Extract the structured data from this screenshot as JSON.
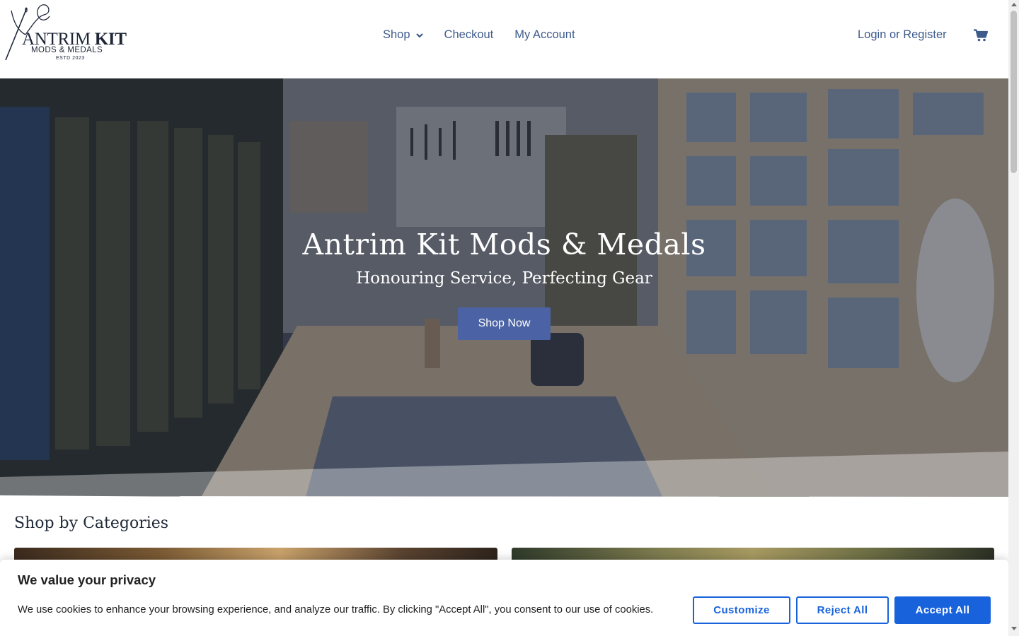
{
  "header": {
    "logo": {
      "name_line": "ANTRIM KIT",
      "subline": "MODS & MEDALS",
      "established": "ESTD 2023"
    },
    "nav": [
      {
        "label": "Shop",
        "has_dropdown": true
      },
      {
        "label": "Checkout"
      },
      {
        "label": "My Account"
      }
    ],
    "login_label": "Login or Register",
    "cart_icon": "cart-icon"
  },
  "hero": {
    "title": "Antrim Kit Mods & Medals",
    "subtitle": "Honouring Service, Perfecting Gear",
    "button_label": "Shop Now"
  },
  "categories": {
    "title": "Shop by Categories"
  },
  "cookie_banner": {
    "title": "We value your privacy",
    "message": "We use cookies to enhance your browsing experience, and analyze our traffic. By clicking \"Accept All\", you consent to our use of cookies.",
    "customize_label": "Customize",
    "reject_label": "Reject All",
    "accept_label": "Accept All"
  },
  "colors": {
    "nav_text": "#3f5b8c",
    "hero_button": "#4b63a5",
    "cookie_accent": "#1863dc"
  }
}
